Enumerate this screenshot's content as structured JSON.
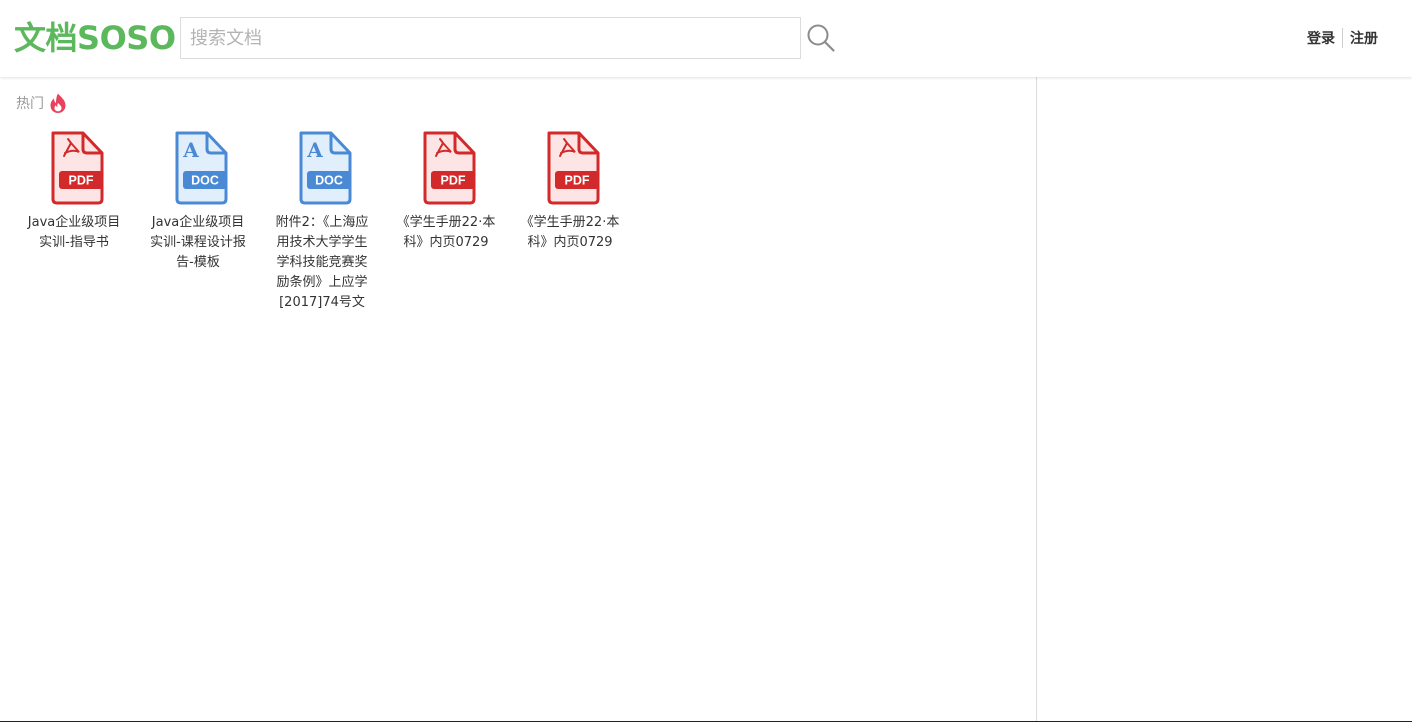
{
  "header": {
    "logo_cn": "文档",
    "logo_en": "SOSO",
    "search_placeholder": "搜索文档",
    "search_value": "",
    "login": "登录",
    "register": "注册"
  },
  "hot": {
    "title": "热门",
    "icon": "flame-icon"
  },
  "documents": [
    {
      "type": "pdf",
      "badge": "PDF",
      "title": "Java企业级项目实训-指导书"
    },
    {
      "type": "doc",
      "badge": "DOC",
      "title": "Java企业级项目实训-课程设计报告-模板"
    },
    {
      "type": "doc",
      "badge": "DOC",
      "title": "附件2：《上海应用技术大学学生学科技能竞赛奖励条例》上应学[2017]74号文"
    },
    {
      "type": "pdf",
      "badge": "PDF",
      "title": "《学生手册22·本科》内页0729"
    },
    {
      "type": "pdf",
      "badge": "PDF",
      "title": "《学生手册22·本科》内页0729"
    }
  ],
  "colors": {
    "logo_green": "#5cb85c",
    "pdf_red": "#d22a2a",
    "pdf_fill": "#fde5e5",
    "doc_blue": "#4a8ad4",
    "doc_fill": "#e1eefb",
    "flame": "#e8425d"
  }
}
